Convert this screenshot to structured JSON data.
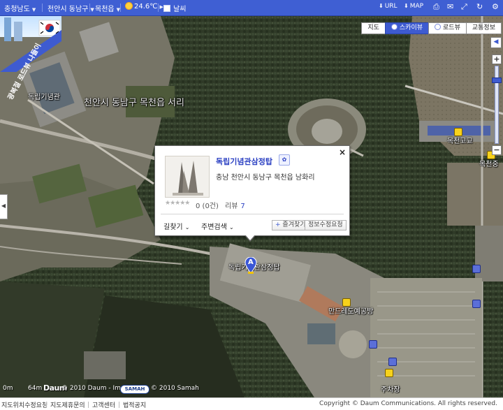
{
  "topbar": {
    "region1": "충청남도",
    "region2": "천안시 동남구",
    "region3": "목천읍",
    "temperature": "24.6℃",
    "weather_toggle": "날씨",
    "url_button": "URL",
    "map_button": "MAP"
  },
  "map_tabs": {
    "map": "지도",
    "skyview": "스카이뷰",
    "roadview": "로드뷰",
    "traffic": "교통정보"
  },
  "map_labels": {
    "hall": "독립기념관",
    "area": "천안시 동남구 목천읍 서리",
    "school1": "목천고교",
    "school2": "목천중",
    "marker_label": "독립기념관삼정탑",
    "mandela": "만드레도예공방",
    "parking": "주차장",
    "ad_text": "광복절 로드뷰 나들이"
  },
  "marker": {
    "letter": "A"
  },
  "popup": {
    "title": "독립기념관삼정탑",
    "address": "충남 천안시 동남구 목천읍 남화리",
    "stars": "★★★★★",
    "rating_text": "0 (0건)",
    "review_label": "리뷰",
    "review_count": "7",
    "directions": "길찾기",
    "nearby": "주변검색",
    "favorite": "즐겨찾기",
    "edit_info": "정보수정요청",
    "close": "×",
    "badge": "✿"
  },
  "bottom": {
    "scale_start": "0m",
    "scale_end": "64m",
    "logo": "Daum",
    "imagery_credit": "© 2010 Daum - Imagery",
    "samah_logo": "SAMAH",
    "samah_credit": "© 2010 Samah"
  },
  "footer": {
    "links": [
      "지도위치수정요청",
      "지도제휴문의",
      "고객센터",
      "법적공지"
    ],
    "copyright": "Copyright © Daum Communications. All rights reserved."
  }
}
